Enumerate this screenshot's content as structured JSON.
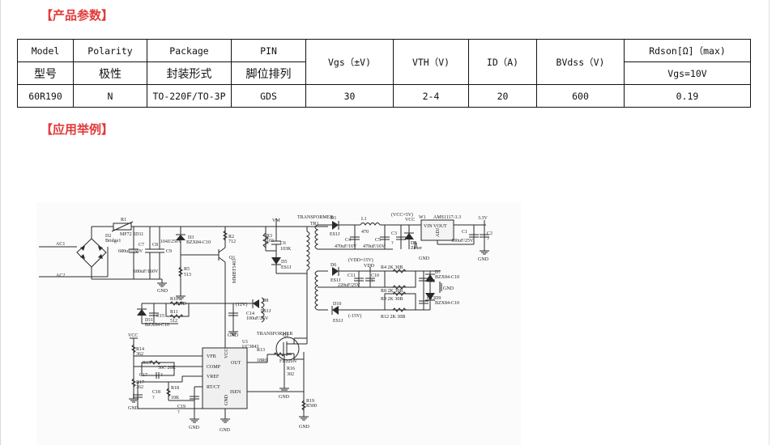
{
  "sections": {
    "params_title": "【产品参数】",
    "application_title": "【应用举例】"
  },
  "table": {
    "header_en": [
      "Model",
      "Polarity",
      "Package",
      "PIN"
    ],
    "header_cn": [
      "型号",
      "极性",
      "封装形式",
      "脚位排列"
    ],
    "header_span": [
      "Vgs（±V)",
      "VTH（V)",
      "ID（A)",
      "BVdss（V)"
    ],
    "rdson_header": "Rdson[Ω]（max)",
    "rdson_sub": "Vgs=10V",
    "row": [
      "60R190",
      "N",
      "TO-220F/TO-3P",
      "GDS",
      "30",
      "2-4",
      "20",
      "600",
      "0.19"
    ]
  },
  "schematic": {
    "labels": {
      "ac1": "AC1",
      "ac2": "AC2",
      "r1": "R1",
      "r1v": "MF72 5D11",
      "d2": "D2",
      "d2v": "Bridge1",
      "c7": "C7",
      "c7v": "680uF/160V",
      "c8": "C8",
      "c8v": "680uF/160V",
      "c9": "C9",
      "c9v": "104J/250V",
      "d3": "D3",
      "d3v": "BZX84-C10",
      "r2": "R2",
      "r2v": "712",
      "q1": "Q1",
      "q1v": "MMBT5401",
      "r5": "R5",
      "r5v": "513",
      "gnd": "GND",
      "vm": "VM",
      "r3": "R3",
      "r3v": "103",
      "c6": "C6",
      "c6v": "103K",
      "d5": "D5",
      "d5v": "ES1J",
      "transformer": "TRANSFORMER",
      "tr1": "TR1",
      "d1": "D1",
      "d1v": "ES1J",
      "l1": "L1",
      "l1v": "470",
      "c4": "C4",
      "c4v": "470uF/16V",
      "c5": "C5",
      "c5v": "470uF/16V",
      "c3": "C3",
      "c3v": "?",
      "vcc5": "(VCC=5V)",
      "vcc": "VCC",
      "d4": "D4",
      "d4v": "Zener",
      "w1": "W1",
      "w1v": "AMS1117-3.3",
      "vinvout": "VIN VOUT",
      "adj": "ADJ",
      "c1": "C1",
      "c1v": "100uF/25V",
      "c2": "C2",
      "c2v": "?",
      "v33": "3.3V",
      "vdd15": "(VDD=15V)",
      "vdd": "VDD",
      "d6": "D6",
      "d6v": "ES1J",
      "c11": "C11",
      "c11v": "220uF/25V",
      "c10": "C10",
      "c10v": "?",
      "r4": "R4  2K  30B",
      "r8": "R8  2K  30B",
      "r9": "R9  2K  30B",
      "r12": "R12 2K  30B",
      "c12": "C12",
      "c13": "C13",
      "d7": "D7",
      "d7v": "BZX84-C10",
      "d9": "D9",
      "d9v": "BZX84-C10",
      "d10": "D10",
      "d10v": "ES1J",
      "vm15": "(-15V)",
      "v12": "(12V)",
      "d8": "D8",
      "d8v": "ES1J",
      "c14": "C14",
      "c14v": "100uF/25V",
      "c15": "C15",
      "r10": "R10",
      "r11": "R11",
      "r11v": "512",
      "d11": "D11",
      "d11v": "BZX84-C10",
      "u1": "U1",
      "u1v": "UC3843",
      "pin_vfb": "VFB",
      "pin_comp": "COMP",
      "pin_vref": "VREF",
      "pin_rtct": "RT/CT",
      "pin_out": "OUT",
      "pin_isen": "ISEN",
      "pin_vcc": "VCC",
      "pin_gnd": "GND",
      "r13": "R13",
      "r13v": "18R0",
      "q2": "Q2",
      "q2v": "FU220N",
      "r16": "R16",
      "r16v": "302",
      "r19": "R19",
      "r19v": "R500",
      "r14": "R14",
      "r14v": "362",
      "r15": "R15",
      "r15v": "30C  20K",
      "c17": "C17",
      "c17v": "?",
      "r17": "R17",
      "r17v": "362",
      "c18": "C18",
      "c18v": "?",
      "r18": "R18",
      "r18v": "10K",
      "c19": "C19",
      "c19v": "?"
    }
  }
}
